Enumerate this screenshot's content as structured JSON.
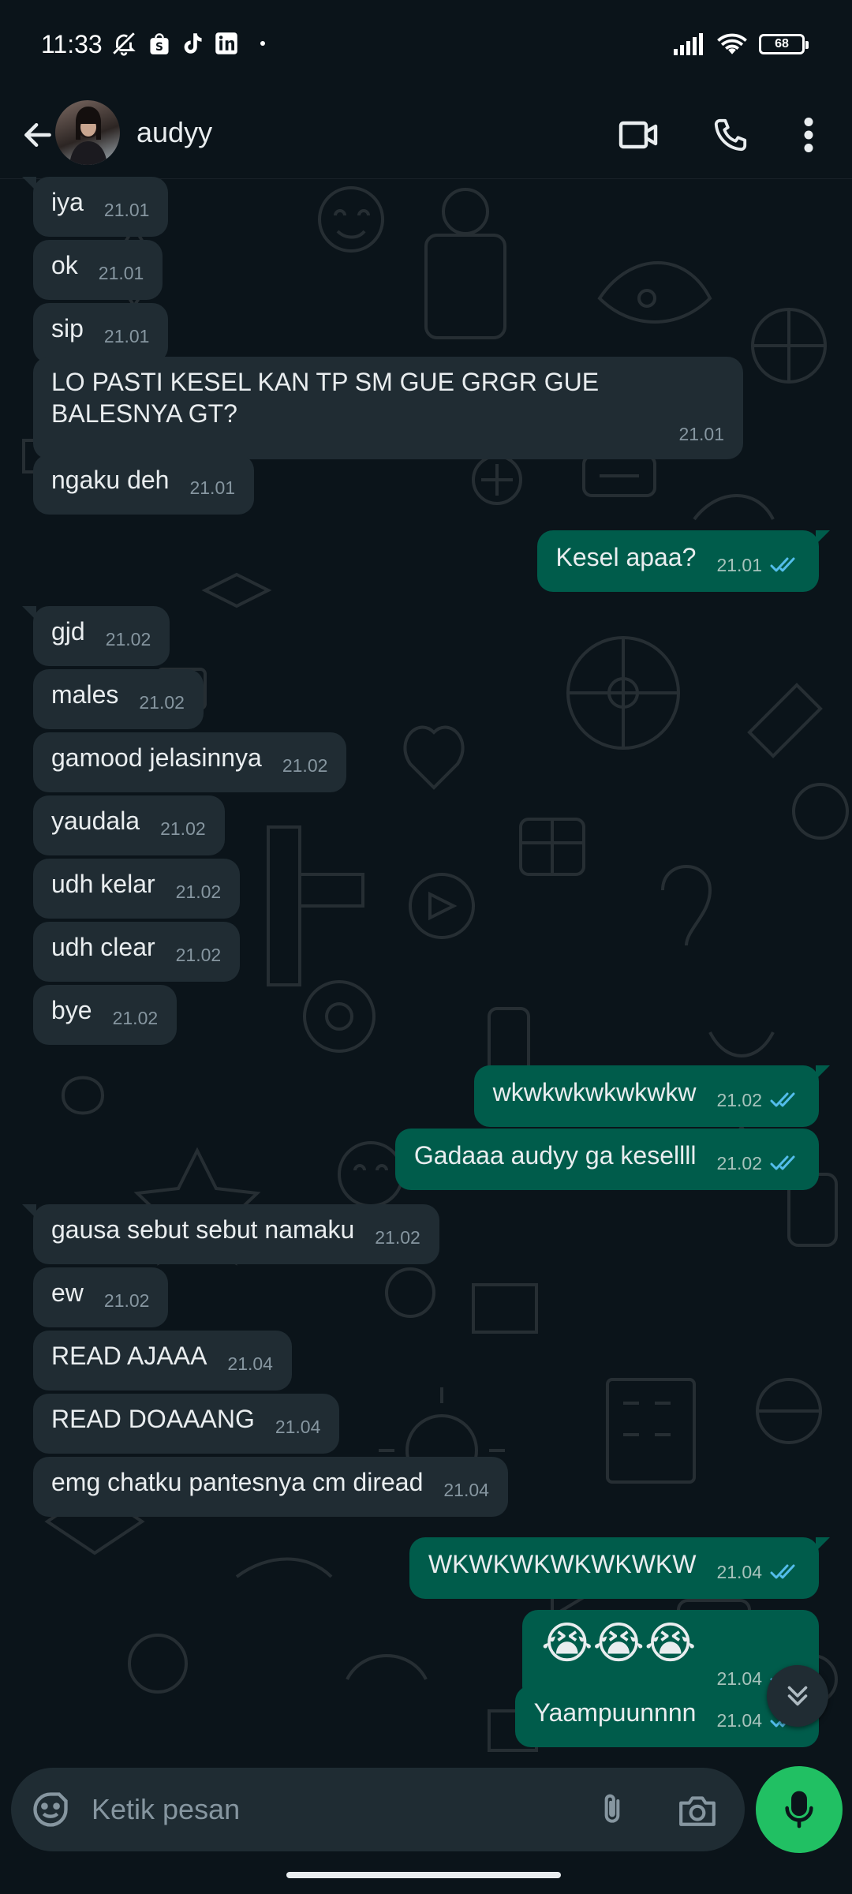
{
  "status_bar": {
    "time": "11:33",
    "battery": "68"
  },
  "header": {
    "contact_name": "audyy"
  },
  "messages": [
    {
      "dir": "in",
      "text": "iya",
      "time": "21.01"
    },
    {
      "dir": "in",
      "text": "ok",
      "time": "21.01"
    },
    {
      "dir": "in",
      "text": "sip",
      "time": "21.01"
    },
    {
      "dir": "in",
      "text": "LO PASTI KESEL KAN TP SM GUE GRGR GUE BALESNYA GT?",
      "time": "21.01"
    },
    {
      "dir": "in",
      "text": "ngaku deh",
      "time": "21.01"
    },
    {
      "dir": "out",
      "text": "Kesel apaa?",
      "time": "21.01"
    },
    {
      "dir": "in",
      "text": "gjd",
      "time": "21.02"
    },
    {
      "dir": "in",
      "text": "males",
      "time": "21.02"
    },
    {
      "dir": "in",
      "text": "gamood jelasinnya",
      "time": "21.02"
    },
    {
      "dir": "in",
      "text": "yaudala",
      "time": "21.02"
    },
    {
      "dir": "in",
      "text": "udh kelar",
      "time": "21.02"
    },
    {
      "dir": "in",
      "text": "udh clear",
      "time": "21.02"
    },
    {
      "dir": "in",
      "text": "bye",
      "time": "21.02"
    },
    {
      "dir": "out",
      "text": "wkwkwkwkwkwkw",
      "time": "21.02"
    },
    {
      "dir": "out",
      "text": "Gadaaa audyy ga kesellll",
      "time": "21.02"
    },
    {
      "dir": "in",
      "text": "gausa sebut sebut namaku",
      "time": "21.02"
    },
    {
      "dir": "in",
      "text": "ew",
      "time": "21.02"
    },
    {
      "dir": "in",
      "text": "READ AJAAA",
      "time": "21.04"
    },
    {
      "dir": "in",
      "text": "READ DOAAANG",
      "time": "21.04"
    },
    {
      "dir": "in",
      "text": "emg chatku pantesnya cm diread",
      "time": "21.04"
    },
    {
      "dir": "out",
      "text": "WKWKWKWKWKWKW",
      "time": "21.04"
    },
    {
      "dir": "out",
      "text": "😭😭😭",
      "time": "21.04"
    },
    {
      "dir": "out",
      "text": "Yaampuunnnn",
      "time": "21.04"
    }
  ],
  "input": {
    "placeholder": "Ketik pesan"
  },
  "colors": {
    "incoming_bubble": "#202c33",
    "outgoing_bubble": "#005c4b",
    "read_ticks": "#53bdeb",
    "mic_button": "#21c063",
    "background": "#0b141a"
  }
}
